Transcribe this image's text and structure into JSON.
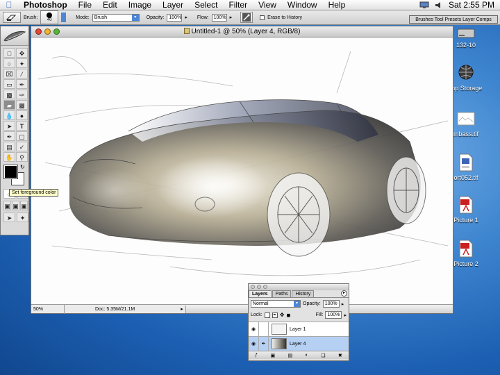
{
  "menubar": {
    "app_name": "Photoshop",
    "items": [
      "File",
      "Edit",
      "Image",
      "Layer",
      "Select",
      "Filter",
      "View",
      "Window",
      "Help"
    ],
    "clock": "Sat 2:55 PM"
  },
  "options": {
    "brush_label": "Brush:",
    "brush_size": "40",
    "mode_label": "Mode:",
    "mode_value": "Brush",
    "opacity_label": "Opacity:",
    "opacity_value": "100%",
    "flow_label": "Flow:",
    "flow_value": "100%",
    "erase_history_label": "Erase to History",
    "palette_well": "Brushes Tool Presets Layer Comps"
  },
  "tooltip": "Set foreground color",
  "document": {
    "title": "Untitled-1 @ 50% (Layer 4, RGB/8)",
    "zoom": "50%",
    "doc_size": "Doc: 5.35M/21.1M"
  },
  "desktop": [
    {
      "label": "132-10",
      "icon": "disk-icon"
    },
    {
      "label": "mp Storage",
      "icon": "network-globe-icon"
    },
    {
      "label": "mbass.tif",
      "icon": "tiff-file-icon"
    },
    {
      "label": "ort052.tif",
      "icon": "tiff-file-icon"
    },
    {
      "label": "Picture 1",
      "icon": "pdf-file-icon"
    },
    {
      "label": "Picture 2",
      "icon": "pdf-file-icon"
    }
  ],
  "layers_panel": {
    "tabs": [
      "Layers",
      "Paths",
      "History"
    ],
    "blend_mode": "Normal",
    "opacity_label": "Opacity:",
    "opacity_value": "100%",
    "lock_label": "Lock:",
    "fill_label": "Fill:",
    "fill_value": "100%",
    "layers": [
      {
        "name": "Layer 1",
        "selected": false
      },
      {
        "name": "Layer 4",
        "selected": true
      }
    ]
  },
  "colors": {
    "accent": "#4d86d6",
    "selection": "#b5d0f2",
    "desktop": "#2a6fc0"
  }
}
